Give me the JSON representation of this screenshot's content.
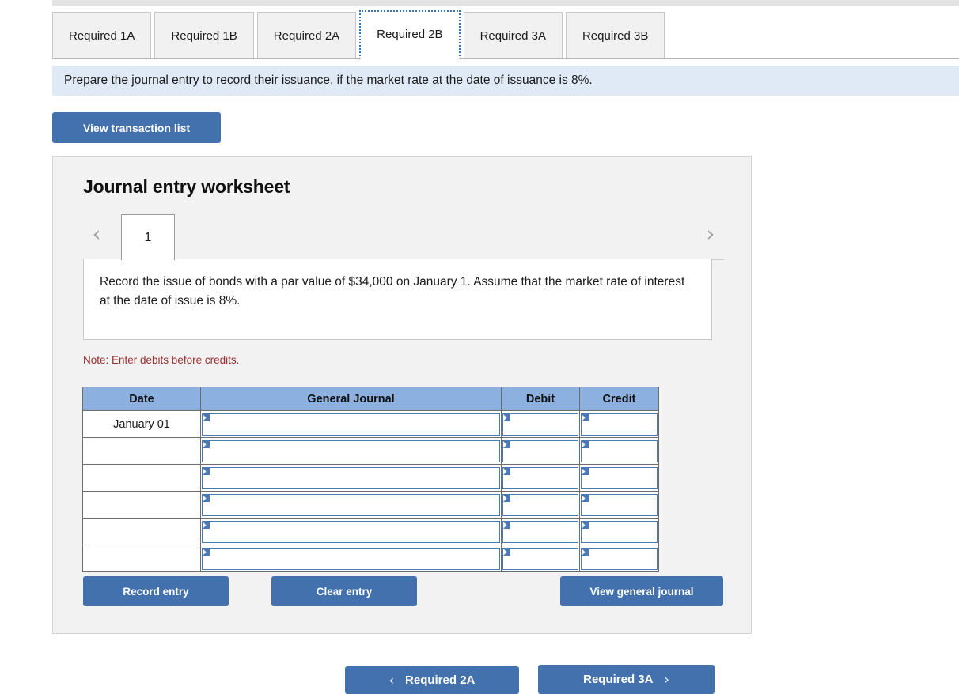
{
  "tabs": [
    {
      "label": "Required 1A",
      "active": false
    },
    {
      "label": "Required 1B",
      "active": false
    },
    {
      "label": "Required 2A",
      "active": false
    },
    {
      "label": "Required 2B",
      "active": true
    },
    {
      "label": "Required 3A",
      "active": false
    },
    {
      "label": "Required 3B",
      "active": false
    }
  ],
  "instruction": "Prepare the journal entry to record their issuance, if the market rate at the date of issuance is 8%.",
  "view_transaction_list_label": "View transaction list",
  "worksheet": {
    "title": "Journal entry worksheet",
    "pager": {
      "prev_icon": "chevron-left-icon",
      "next_icon": "chevron-right-icon",
      "current_page": "1"
    },
    "description": "Record the issue of bonds with a par value of $34,000 on January 1. Assume that the market rate of interest at the date of issue is 8%.",
    "note": "Note: Enter debits before credits.",
    "table": {
      "headers": [
        "Date",
        "General Journal",
        "Debit",
        "Credit"
      ],
      "rows": [
        {
          "date": "January 01",
          "general_journal": "",
          "debit": "",
          "credit": ""
        },
        {
          "date": "",
          "general_journal": "",
          "debit": "",
          "credit": ""
        },
        {
          "date": "",
          "general_journal": "",
          "debit": "",
          "credit": ""
        },
        {
          "date": "",
          "general_journal": "",
          "debit": "",
          "credit": ""
        },
        {
          "date": "",
          "general_journal": "",
          "debit": "",
          "credit": ""
        },
        {
          "date": "",
          "general_journal": "",
          "debit": "",
          "credit": ""
        }
      ]
    },
    "actions": {
      "record_entry_label": "Record entry",
      "clear_entry_label": "Clear entry",
      "view_general_journal_label": "View general journal"
    }
  },
  "bottom_nav": {
    "prev_label": "Required 2A",
    "prev_icon": "chevron-left-icon",
    "next_label": "Required 3A",
    "next_icon": "chevron-right-icon"
  },
  "colors": {
    "accent_blue": "#4271ae",
    "header_blue": "#8cb0df",
    "banner_blue": "#dfeaf6",
    "note_red": "#9b2f2f",
    "panel_gray": "#f2f2f2"
  }
}
